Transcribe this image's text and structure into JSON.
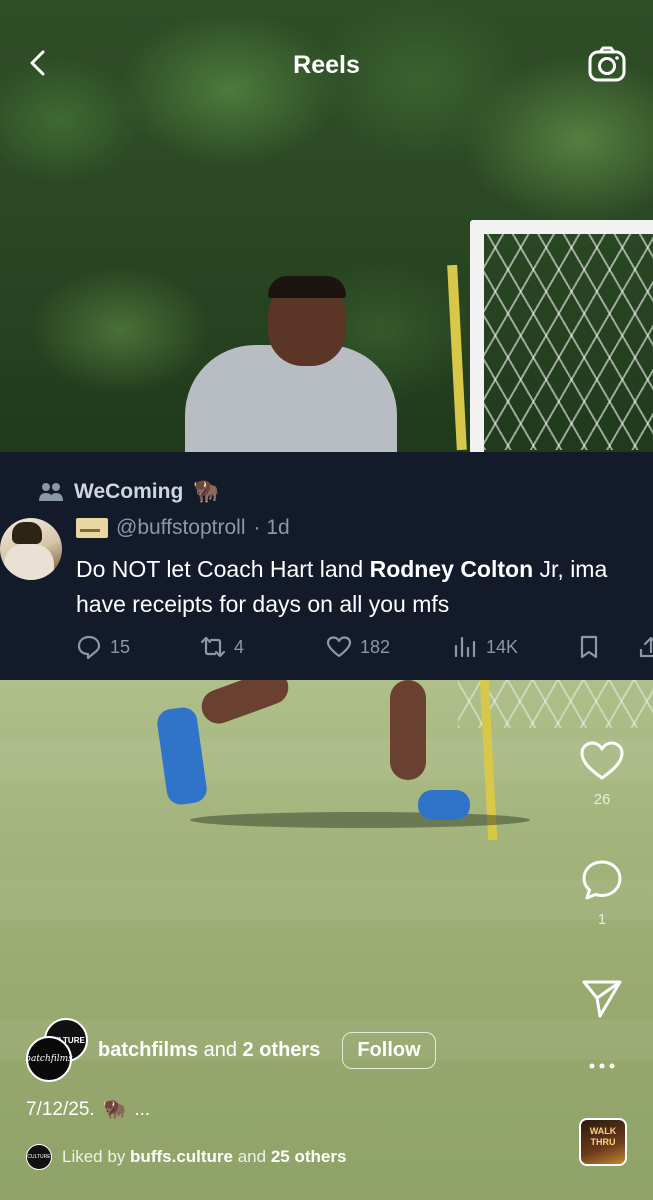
{
  "header": {
    "title": "Reels",
    "back_icon": "chevron-left-icon",
    "camera_icon": "camera-icon"
  },
  "tweet": {
    "community": "WeComing",
    "community_emoji": "🦬",
    "handle": "@buffstoptroll",
    "age": "· 1d",
    "text_part1": "Do NOT let Coach Hart land ",
    "text_bold": "Rodney Colton",
    "text_part2": " Jr, ima have receipts for days on all you mfs",
    "stats": {
      "replies": "15",
      "reposts": "4",
      "likes": "182",
      "views": "14K"
    }
  },
  "actions": {
    "likes": "26",
    "comments": "1"
  },
  "author": {
    "avatar1_text": "CULTURE",
    "avatar2_text": "batchfilms",
    "name": "batchfilms",
    "and": " and ",
    "others": "2 others",
    "follow_label": "Follow"
  },
  "caption": {
    "date": "7/12/25.",
    "emoji": "🦬",
    "more": "..."
  },
  "liked_by": {
    "avatar_text": "CULTURE",
    "prefix": "Liked by ",
    "user": "buffs.culture",
    "middle": " and ",
    "others": "25 others"
  },
  "audio": {
    "label": "WALK THRU"
  },
  "colors": {
    "tweet_bg": "#131a2a",
    "muted": "#8b98a5",
    "text": "#ffffff"
  }
}
